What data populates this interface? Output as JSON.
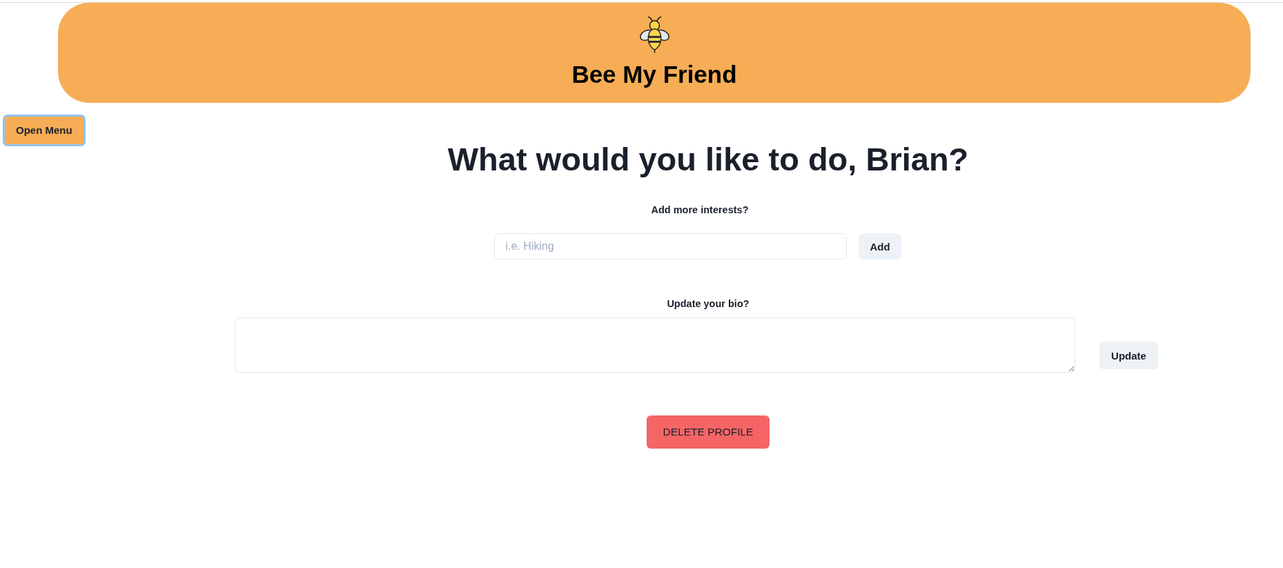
{
  "header": {
    "title": "Bee My Friend"
  },
  "menu_button": {
    "label": "Open Menu",
    "focused": true
  },
  "heading": "What would you like to do, Brian?",
  "interests": {
    "label": "Add more interests?",
    "placeholder": "i.e. Hiking",
    "button": "Add"
  },
  "bio": {
    "label": "Update your bio?",
    "button": "Update"
  },
  "delete_button": {
    "label": "DELETE PROFILE"
  }
}
